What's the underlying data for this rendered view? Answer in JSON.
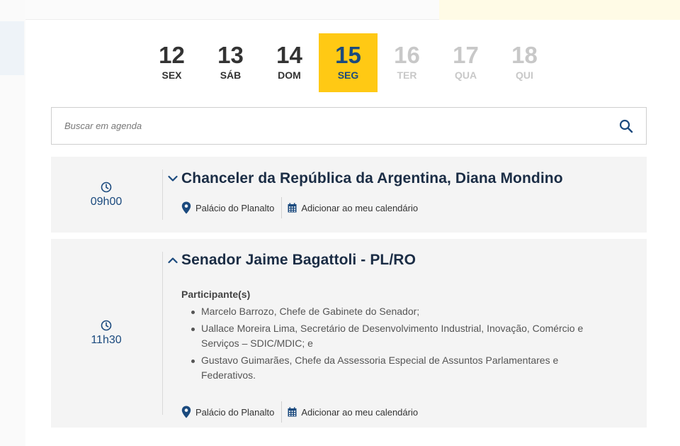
{
  "dates": [
    {
      "num": "12",
      "dow": "SEX",
      "state": "past"
    },
    {
      "num": "13",
      "dow": "SÁB",
      "state": "past"
    },
    {
      "num": "14",
      "dow": "DOM",
      "state": "past"
    },
    {
      "num": "15",
      "dow": "SEG",
      "state": "active"
    },
    {
      "num": "16",
      "dow": "TER",
      "state": "future"
    },
    {
      "num": "17",
      "dow": "QUA",
      "state": "future"
    },
    {
      "num": "18",
      "dow": "QUI",
      "state": "future"
    }
  ],
  "search": {
    "placeholder": "Buscar em agenda",
    "icon": "search-icon"
  },
  "events": [
    {
      "time": "09h00",
      "title": "Chanceler da República da Argentina, Diana Mondino",
      "expanded": false,
      "location": "Palácio do Planalto",
      "add_calendar": "Adicionar ao meu calendário"
    },
    {
      "time": "11h30",
      "title": "Senador Jaime Bagattoli - PL/RO",
      "expanded": true,
      "participants_label": "Participante(s)",
      "participants": [
        "Marcelo Barrozo, Chefe de Gabinete do Senador;",
        "Uallace Moreira Lima, Secretário de Desenvolvimento Industrial, Inovação, Comércio e Serviços – SDIC/MDIC; e",
        "Gustavo Guimarães, Chefe da Assessoria Especial de Assuntos Parlamentares e Federativos."
      ],
      "location": "Palácio do Planalto",
      "add_calendar": "Adicionar ao meu calendário"
    }
  ],
  "colors": {
    "accent": "#ffc914",
    "primary": "#1b4a7e",
    "title": "#1b2d45",
    "card_bg": "#f4f4f4"
  }
}
